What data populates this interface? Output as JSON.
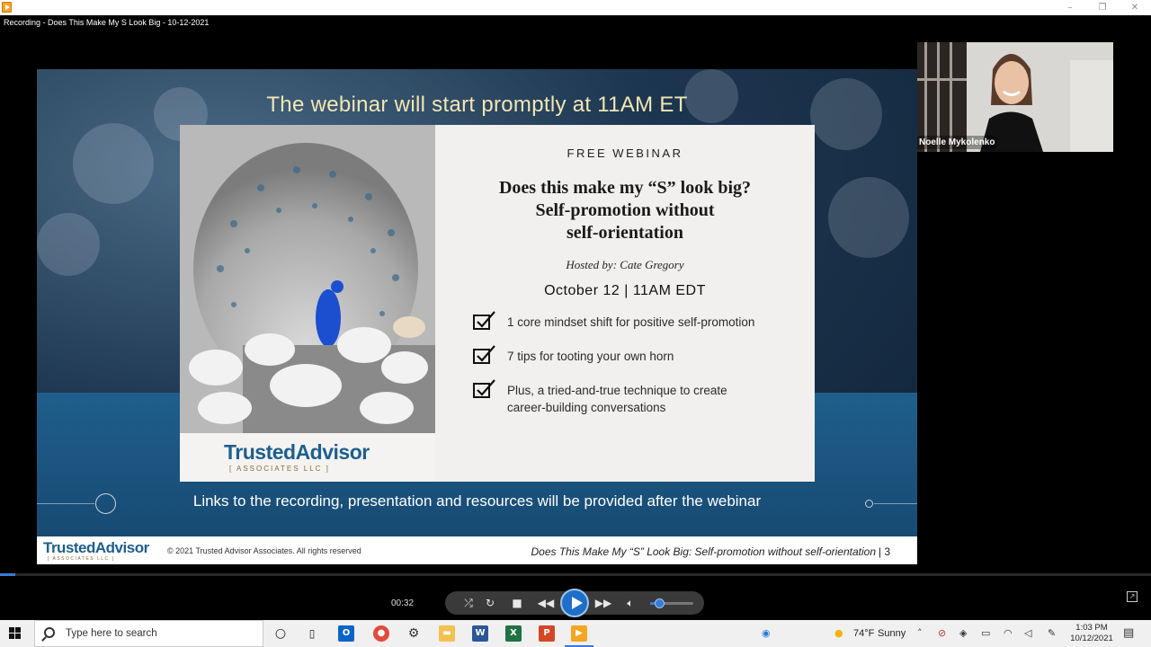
{
  "window": {
    "min_glyph": "–",
    "restore_glyph": "❐",
    "close_glyph": "✕"
  },
  "player": {
    "recording_title": "Recording - Does This Make My S Look Big - 10-12-2021",
    "elapsed_time": "00:32",
    "progress_fraction": 0.013,
    "volume_fraction": 0.2
  },
  "slide": {
    "headline": "The webinar will start promptly at 11AM ET",
    "free_label": "FREE WEBINAR",
    "title_lines": [
      "Does this make my “S” look big?",
      "Self-promotion without",
      "self-orientation"
    ],
    "hosted_by": "Hosted by: Cate Gregory",
    "date": "October 12 | 11AM EDT",
    "bullets": [
      "1 core mindset shift for positive self-promotion",
      "7 tips for tooting your own horn",
      "Plus, a tried-and-true technique to create",
      "career-building conversations"
    ],
    "logo_main": "TrustedAdvisor",
    "logo_sub": "[ ASSOCIATES LLC ]",
    "footer_line": "Links to the recording, presentation and resources will be provided after the webinar",
    "bottom": {
      "logo_main": "TrustedAdvisor",
      "logo_sub": "[ ASSOCIATES LLC ]",
      "copyright": "© 2021 Trusted Advisor Associates. All rights reserved",
      "deck_title": "Does This Make My “S” Look Big: Self-promotion without self-orientation",
      "page": "| 3"
    }
  },
  "speaker": {
    "name": "Noelle Mykolenko"
  },
  "taskbar": {
    "search_placeholder": "Type here to search",
    "weather_temp": "74°F",
    "weather_desc": "Sunny",
    "time": "1:03 PM",
    "date": "10/12/2021"
  }
}
